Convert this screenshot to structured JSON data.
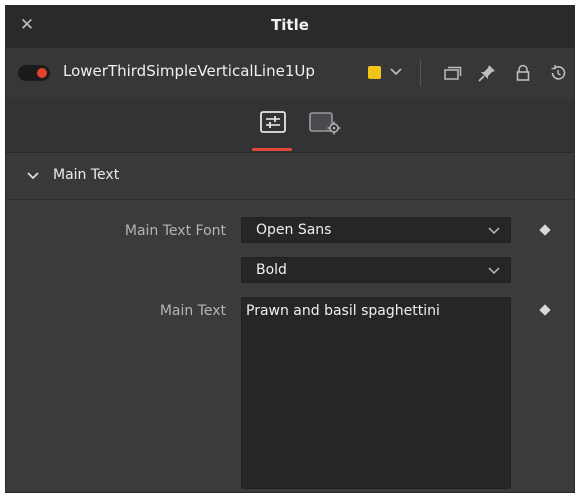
{
  "window": {
    "title": "Title",
    "close_icon": "close-icon"
  },
  "node": {
    "name": "LowerThirdSimpleVerticalLine1Up",
    "enabled": true,
    "color": "#f0c419",
    "icons": [
      "node-enable-toggle-icon",
      "chevron-down-icon",
      "versions-icon",
      "pin-icon",
      "lock-icon",
      "reset-icon"
    ]
  },
  "tabs": [
    {
      "icon": "sliders-icon",
      "active": true
    },
    {
      "icon": "settings-gear-icon",
      "active": false
    }
  ],
  "accent_color": "#e5483a",
  "section": {
    "label": "Main Text",
    "expanded": true
  },
  "fields": {
    "font_label": "Main Text Font",
    "font_value": "Open Sans",
    "style_value": "Bold",
    "text_label": "Main Text",
    "text_value": "Prawn and basil spaghettini"
  }
}
